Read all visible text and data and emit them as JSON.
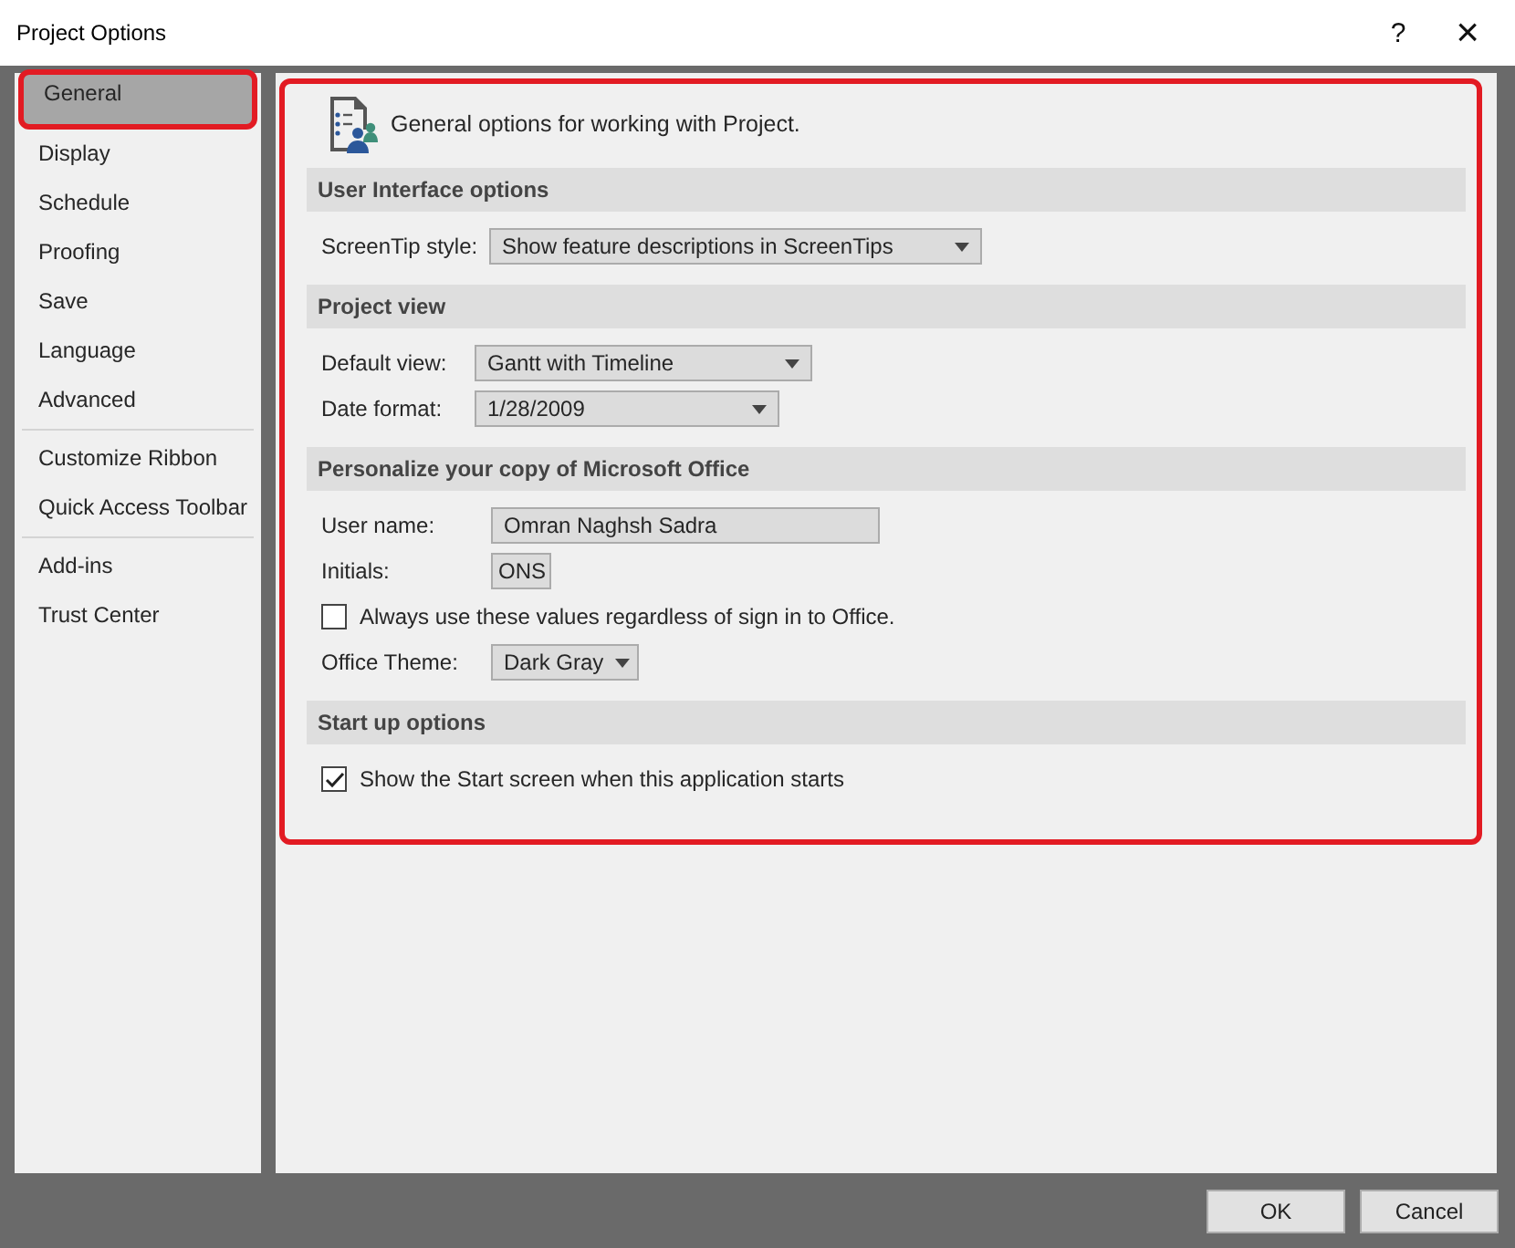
{
  "window": {
    "title": "Project Options",
    "help": "?",
    "close": "×"
  },
  "sidebar": {
    "groups": [
      [
        {
          "label": "General",
          "selected": true
        },
        {
          "label": "Display",
          "selected": false
        },
        {
          "label": "Schedule",
          "selected": false
        },
        {
          "label": "Proofing",
          "selected": false
        },
        {
          "label": "Save",
          "selected": false
        },
        {
          "label": "Language",
          "selected": false
        },
        {
          "label": "Advanced",
          "selected": false
        }
      ],
      [
        {
          "label": "Customize Ribbon",
          "selected": false
        },
        {
          "label": "Quick Access Toolbar",
          "selected": false
        }
      ],
      [
        {
          "label": "Add-ins",
          "selected": false
        },
        {
          "label": "Trust Center",
          "selected": false
        }
      ]
    ]
  },
  "header": "General options for working with Project.",
  "sections": [
    {
      "title": "User Interface options",
      "rows": [
        {
          "kind": "dropdown",
          "label": "ScreenTip style:",
          "value": "Show feature descriptions in ScreenTips"
        }
      ]
    },
    {
      "title": "Project view",
      "rows": [
        {
          "kind": "dropdown",
          "label": "Default view:",
          "value": "Gantt with Timeline"
        },
        {
          "kind": "dropdown",
          "label": "Date format:",
          "value": "1/28/2009"
        }
      ]
    },
    {
      "title": "Personalize your copy of Microsoft Office",
      "rows": [
        {
          "kind": "text",
          "label": "User name:",
          "value": "Omran Naghsh Sadra"
        },
        {
          "kind": "text",
          "label": "Initials:",
          "value": "ONS"
        },
        {
          "kind": "checkbox",
          "label": "Always use these values regardless of sign in to Office.",
          "checked": false
        },
        {
          "kind": "dropdown",
          "label": "Office Theme:",
          "value": "Dark Gray"
        }
      ]
    },
    {
      "title": "Start up options",
      "rows": [
        {
          "kind": "checkbox",
          "label": "Show the Start screen when this application starts",
          "checked": true
        }
      ]
    }
  ],
  "buttons": [
    "OK",
    "Cancel"
  ]
}
